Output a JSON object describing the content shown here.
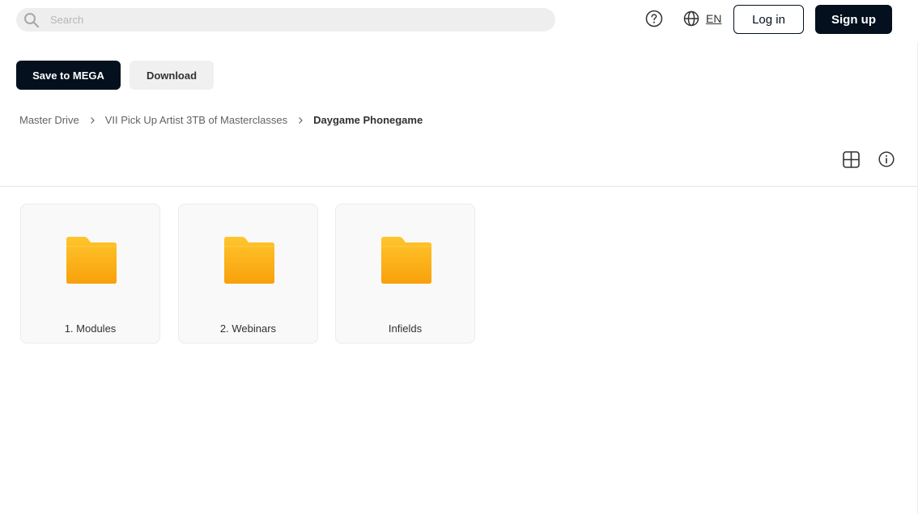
{
  "header": {
    "search": {
      "placeholder": "Search",
      "value": ""
    },
    "help_icon": "question-circle-icon",
    "language": {
      "icon": "globe-icon",
      "label": "EN"
    },
    "login_label": "Log in",
    "signup_label": "Sign up"
  },
  "toolbar": {
    "save_label": "Save to MEGA",
    "download_label": "Download"
  },
  "breadcrumb": [
    {
      "label": "Master Drive"
    },
    {
      "label": "VII Pick Up Artist 3TB of Masterclasses"
    },
    {
      "label": "Daygame Phonegame"
    }
  ],
  "view_controls": {
    "grid_icon": "grid-view-icon",
    "info_icon": "info-icon"
  },
  "folders": [
    {
      "name": "1. Modules"
    },
    {
      "name": "2. Webinars"
    },
    {
      "name": "Infields"
    }
  ],
  "colors": {
    "primary": "#04101e",
    "folder_top": "#ffc52d",
    "folder_bottom": "#f8a10b",
    "tile_bg": "#f9f9f9"
  }
}
